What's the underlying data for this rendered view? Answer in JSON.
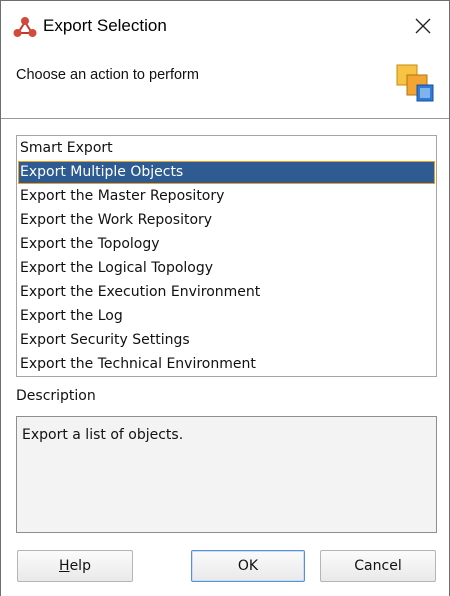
{
  "window": {
    "title": "Export Selection"
  },
  "header": {
    "prompt": "Choose an action to perform"
  },
  "actions": {
    "items": [
      "Smart Export",
      "Export Multiple Objects",
      "Export the Master Repository",
      "Export the Work Repository",
      "Export the Topology",
      "Export the Logical Topology",
      "Export the Execution Environment",
      "Export the Log",
      "Export Security Settings",
      "Export the Technical Environment"
    ],
    "selected_index": 1
  },
  "description": {
    "label": "Description",
    "text": "Export a list of objects."
  },
  "buttons": {
    "help_mnemonic": "H",
    "help_rest": "elp",
    "ok": "OK",
    "cancel": "Cancel"
  },
  "icons": {
    "app": "odi-network-icon",
    "close": "close-icon",
    "header": "export-layers-icon"
  },
  "colors": {
    "selection_bg": "#2e5c92",
    "selection_outline": "#f0a020",
    "default_button_border": "#5b8fd2"
  }
}
